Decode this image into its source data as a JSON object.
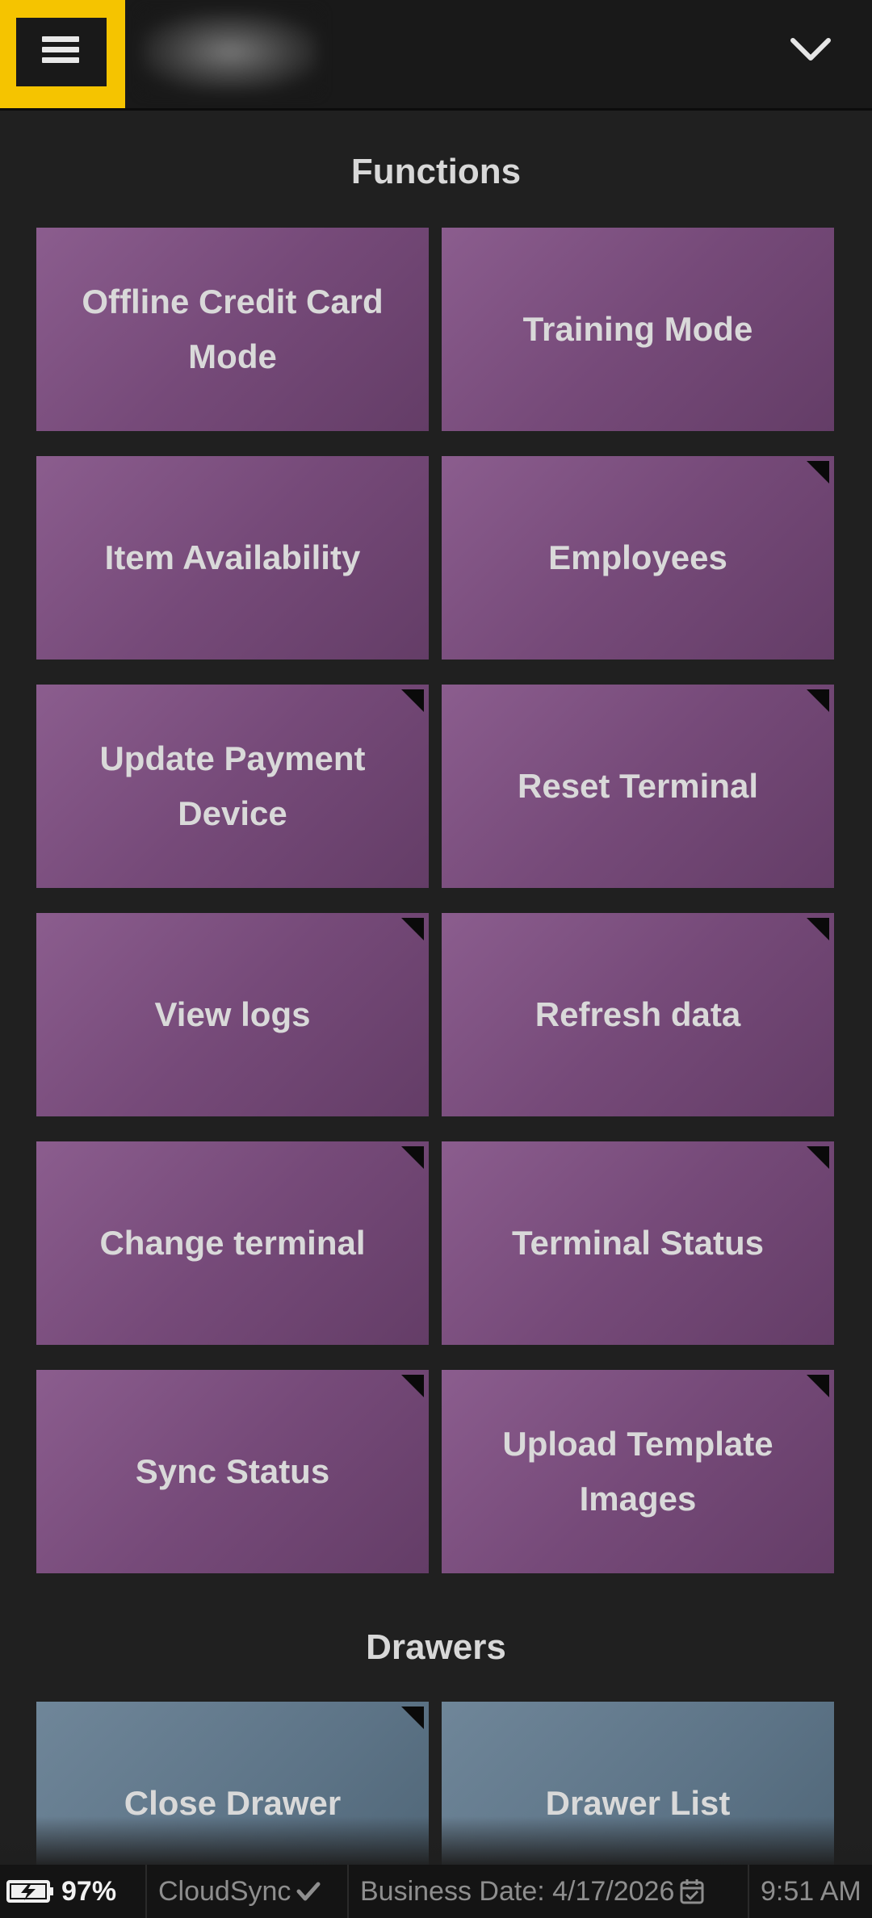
{
  "header": {
    "menu_icon": "hamburger-icon",
    "expand_icon": "chevron-down-icon",
    "highlight_color": "#f5c400"
  },
  "functions": {
    "title": "Functions",
    "tiles": [
      {
        "label": "Offline Credit Card Mode",
        "corner": false
      },
      {
        "label": "Training Mode",
        "corner": false
      },
      {
        "label": "Item Availability",
        "corner": false
      },
      {
        "label": "Employees",
        "corner": true
      },
      {
        "label": "Update Payment Device",
        "corner": true
      },
      {
        "label": "Reset Terminal",
        "corner": true
      },
      {
        "label": "View logs",
        "corner": true
      },
      {
        "label": "Refresh data",
        "corner": true
      },
      {
        "label": "Change terminal",
        "corner": true
      },
      {
        "label": "Terminal Status",
        "corner": true
      },
      {
        "label": "Sync Status",
        "corner": true
      },
      {
        "label": "Upload Template Images",
        "corner": true
      }
    ],
    "tile_color": "#7a4d7d"
  },
  "drawers": {
    "title": "Drawers",
    "tiles": [
      {
        "label": "Close Drawer",
        "corner": true
      },
      {
        "label": "Drawer List",
        "corner": false
      }
    ],
    "tile_color": "#5f7689"
  },
  "status_bar": {
    "battery_icon": "battery-charging-icon",
    "battery": "97%",
    "sync_label": "CloudSync",
    "sync_icon": "checkmark-icon",
    "business_date": "Business Date: 4/17/2026",
    "calendar_icon": "calendar-check-icon",
    "time": "9:51 AM"
  }
}
